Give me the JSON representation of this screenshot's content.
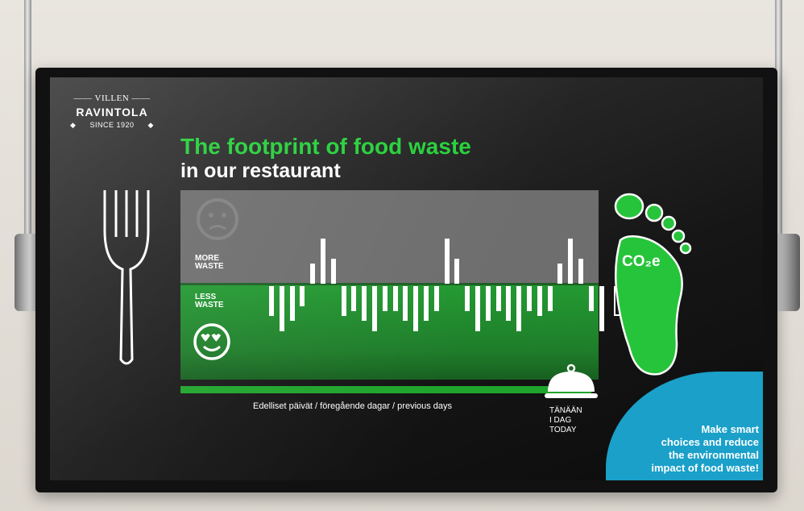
{
  "brand": {
    "top": "VILLEN",
    "name": "RAVINTOLA",
    "since": "SINCE 1920"
  },
  "headline": {
    "line1": "The footprint of food waste",
    "line2": "in our restaurant"
  },
  "panel": {
    "more_line1": "MORE",
    "more_line2": "WASTE",
    "less_line1": "LESS",
    "less_line2": "WASTE"
  },
  "chart_data": {
    "type": "bar",
    "description_axis": "Edelliset päivät / föregående dagar / previous days",
    "values": [
      -6,
      -9,
      -7,
      -4,
      4,
      9,
      5,
      -6,
      -5,
      -7,
      -9,
      -5,
      -5,
      -7,
      -9,
      -7,
      -5,
      9,
      5,
      -5,
      -9,
      -7,
      -5,
      -7,
      -9,
      -5,
      -6,
      -5,
      4,
      9,
      5,
      -5,
      -9
    ],
    "today_value": -6,
    "ylim": [
      -10,
      10
    ]
  },
  "timeline": {
    "caption": "Edelliset päivät / föregående dagar / previous days",
    "today_line1": "TÄNÄÄN",
    "today_line2": "I DAG",
    "today_line3": "TODAY"
  },
  "footprint": {
    "label": "CO₂e"
  },
  "cta": {
    "line1": "Make smart",
    "line2": "choices and reduce",
    "line3": "the environmental",
    "line4": "impact of food waste!"
  },
  "colors": {
    "green": "#26d13a",
    "dark_green": "#1f7d2a",
    "blue": "#1aa0c9",
    "gray": "#6e6e6e"
  },
  "icons": [
    "fork-icon",
    "sad-face-icon",
    "love-face-icon",
    "footprint-icon",
    "cloche-icon"
  ]
}
